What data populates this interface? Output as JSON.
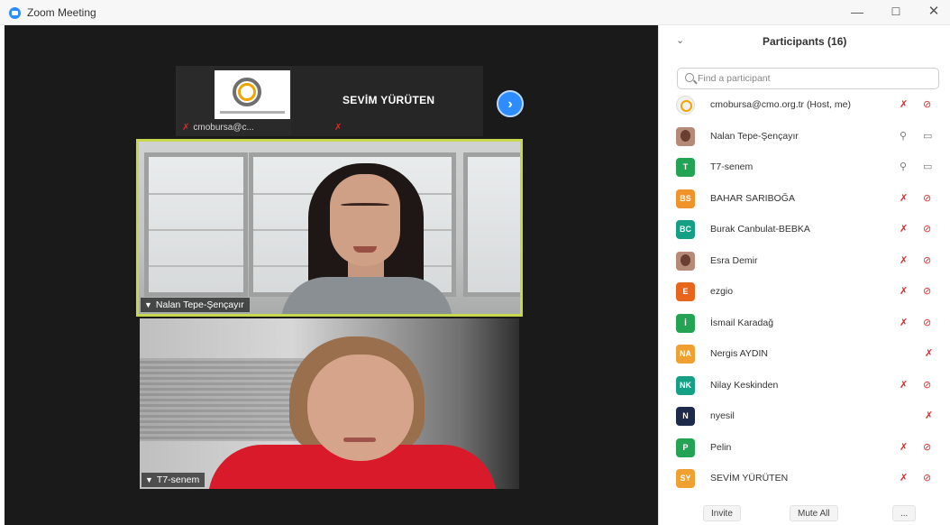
{
  "window": {
    "title": "Zoom Meeting",
    "minimize": "—",
    "maximize": "☐",
    "close": "✕"
  },
  "thumbs": {
    "host_label": "cmobursa@c...",
    "speaker_name": "SEVİM YÜRÜTEN",
    "next": "›"
  },
  "tiles": {
    "active_name": "Nalan Tepe-Şençayır",
    "second_name": "T7-senem"
  },
  "panel": {
    "collapse": "⌄",
    "title": "Participants (16)",
    "search_placeholder": "Find a participant",
    "participants": [
      {
        "name": "cmobursa@cmo.org.tr (Host, me)",
        "initials": "",
        "avatar_color": "#f1f1f1",
        "mic": "off",
        "cam": "off"
      },
      {
        "name": "Nalan Tepe-Şençayır",
        "initials": "",
        "avatar_color": "#b58a78",
        "mic": "on",
        "cam": "on"
      },
      {
        "name": "T7-senem",
        "initials": "T",
        "avatar_color": "#23a455",
        "mic": "on",
        "cam": "on"
      },
      {
        "name": "BAHAR SARIBOĞA",
        "initials": "BS",
        "avatar_color": "#f0932b",
        "mic": "off",
        "cam": "off"
      },
      {
        "name": "Burak Canbulat-BEBKA",
        "initials": "BC",
        "avatar_color": "#15a085",
        "mic": "off",
        "cam": "off"
      },
      {
        "name": "Esra Demir",
        "initials": "",
        "avatar_color": "#b58a78",
        "mic": "off",
        "cam": "off"
      },
      {
        "name": "ezgio",
        "initials": "E",
        "avatar_color": "#e8651c",
        "mic": "off",
        "cam": "off"
      },
      {
        "name": "İsmail Karadağ",
        "initials": "İ",
        "avatar_color": "#23a455",
        "mic": "off",
        "cam": "off"
      },
      {
        "name": "Nergis AYDIN",
        "initials": "NA",
        "avatar_color": "#f0a030",
        "mic": "off",
        "cam": ""
      },
      {
        "name": "Nilay Keskinden",
        "initials": "NK",
        "avatar_color": "#15a085",
        "mic": "off",
        "cam": "off"
      },
      {
        "name": "nyesil",
        "initials": "N",
        "avatar_color": "#1e2a4a",
        "mic": "off",
        "cam": ""
      },
      {
        "name": "Pelin",
        "initials": "P",
        "avatar_color": "#23a455",
        "mic": "off",
        "cam": "off"
      },
      {
        "name": "SEVİM YÜRÜTEN",
        "initials": "SY",
        "avatar_color": "#f0a030",
        "mic": "off",
        "cam": "off"
      }
    ],
    "footer": {
      "invite": "Invite",
      "mute_all": "Mute All",
      "more": "..."
    }
  },
  "icons": {
    "mic_off": "✗",
    "cam_off": "▭",
    "mic_on": "🎙",
    "cam_on": "▭"
  }
}
